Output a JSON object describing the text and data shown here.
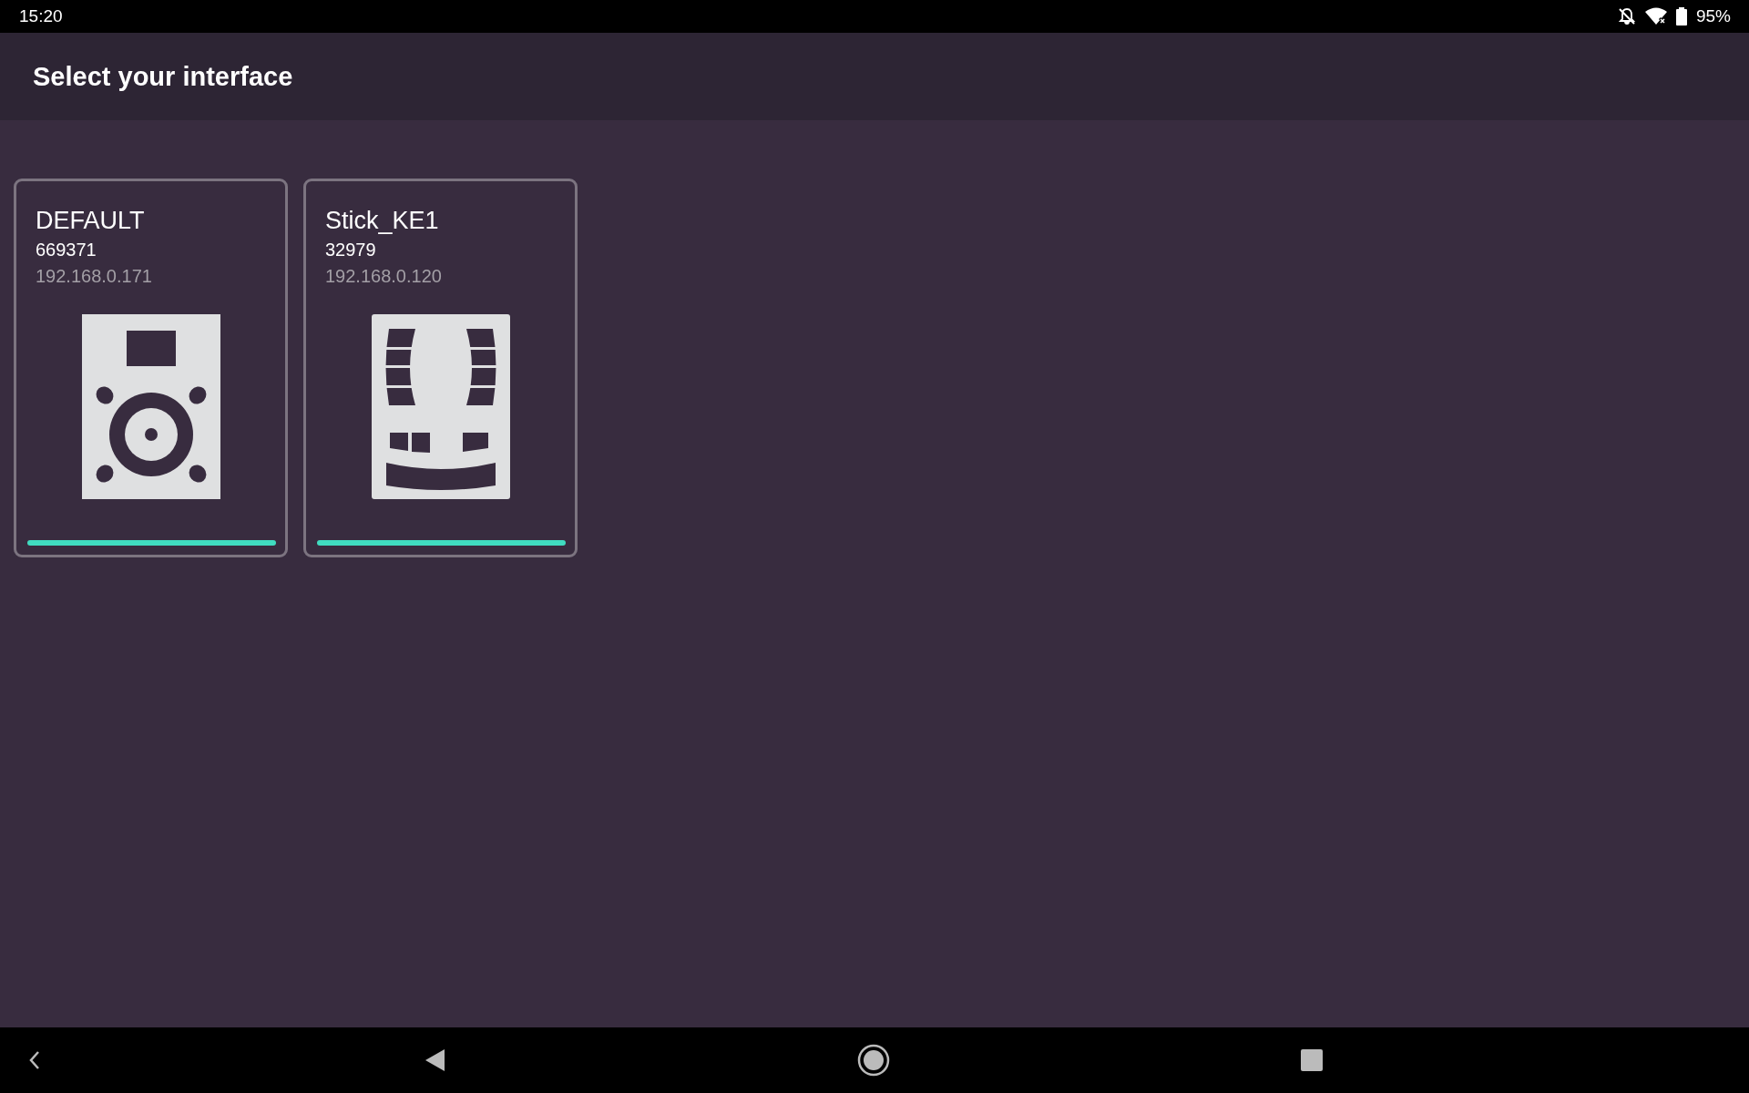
{
  "status_bar": {
    "time": "15:20",
    "battery": "95%"
  },
  "app_bar": {
    "title": "Select your interface"
  },
  "devices": [
    {
      "kind": "speaker",
      "name": "DEFAULT",
      "id": "669371",
      "ip": "192.168.0.171"
    },
    {
      "kind": "controller",
      "name": "Stick_KE1",
      "id": "32979",
      "ip": "192.168.0.120"
    }
  ]
}
